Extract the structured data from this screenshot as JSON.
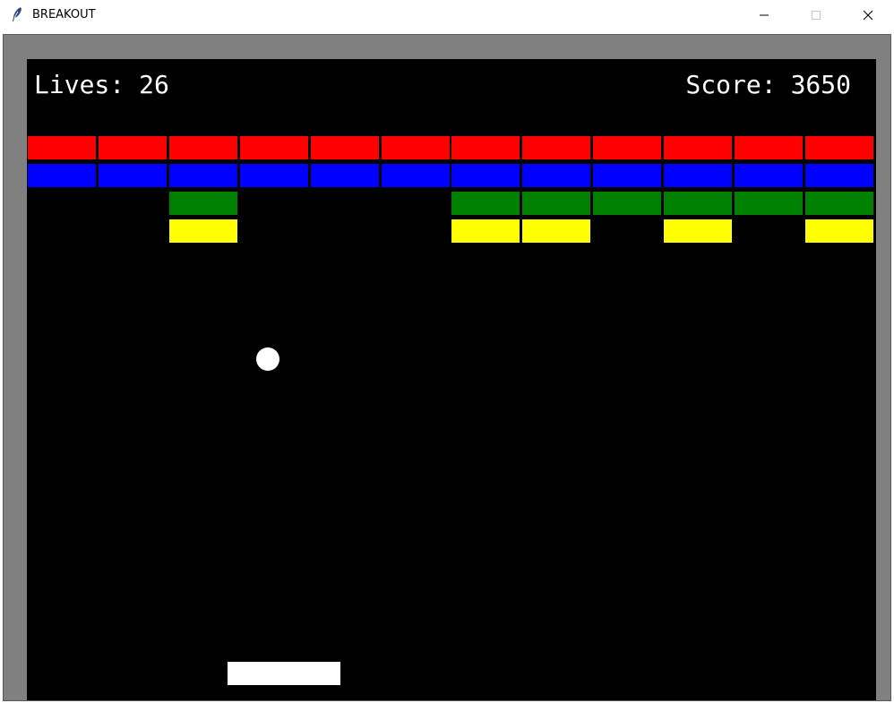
{
  "window": {
    "title": "BREAKOUT",
    "icon": "feather-icon",
    "controls": [
      "minimize-icon",
      "maximize-icon",
      "close-icon"
    ]
  },
  "hud": {
    "lives_label": "Lives:",
    "lives_value": "26",
    "score_label": "Score:",
    "score_value": "3650"
  },
  "colors": {
    "background": "#000000",
    "frame": "#808080",
    "red": "#ff0000",
    "blue": "#0000ff",
    "green": "#008000",
    "yellow": "#ffff00",
    "ball": "#ffffff",
    "paddle": "#ffffff"
  },
  "bricks": {
    "columns": 12,
    "rows": [
      {
        "color": "red",
        "present": [
          1,
          1,
          1,
          1,
          1,
          1,
          1,
          1,
          1,
          1,
          1,
          1
        ]
      },
      {
        "color": "blue",
        "present": [
          1,
          1,
          1,
          1,
          1,
          1,
          1,
          1,
          1,
          1,
          1,
          1
        ]
      },
      {
        "color": "green",
        "present": [
          0,
          0,
          1,
          0,
          0,
          0,
          1,
          1,
          1,
          1,
          1,
          1
        ]
      },
      {
        "color": "yellow",
        "present": [
          0,
          0,
          1,
          0,
          0,
          0,
          1,
          1,
          0,
          1,
          0,
          1
        ]
      }
    ]
  }
}
